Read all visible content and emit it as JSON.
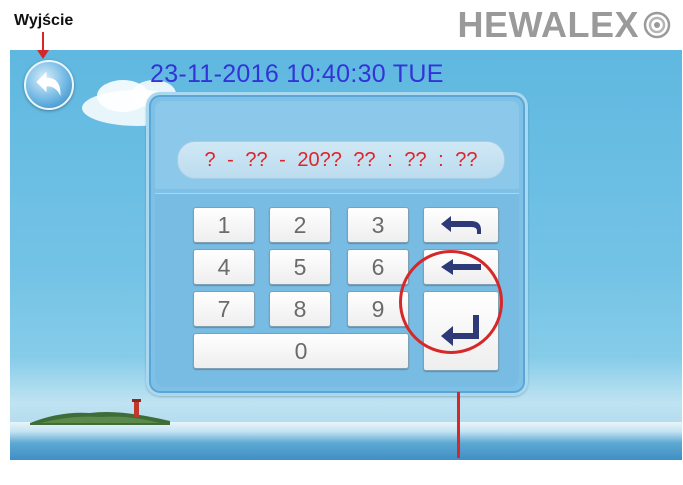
{
  "annotation": {
    "exit_label": "Wyjście"
  },
  "brand": {
    "name": "HEWALEX"
  },
  "screen": {
    "datetime": "23-11-2016  10:40:30  TUE",
    "date_field": "? - ?? - 20??   ?? : ?? : ??"
  },
  "keypad": {
    "digits": [
      "1",
      "2",
      "3",
      "4",
      "5",
      "6",
      "7",
      "8",
      "9",
      "0"
    ],
    "icons": {
      "back": "undo-arrow-icon",
      "backspace": "backspace-arrow-icon",
      "enter": "enter-return-icon"
    }
  },
  "colors": {
    "highlight": "#d62828",
    "datetime_text": "#3233d8",
    "date_field_text": "#e0232a"
  }
}
